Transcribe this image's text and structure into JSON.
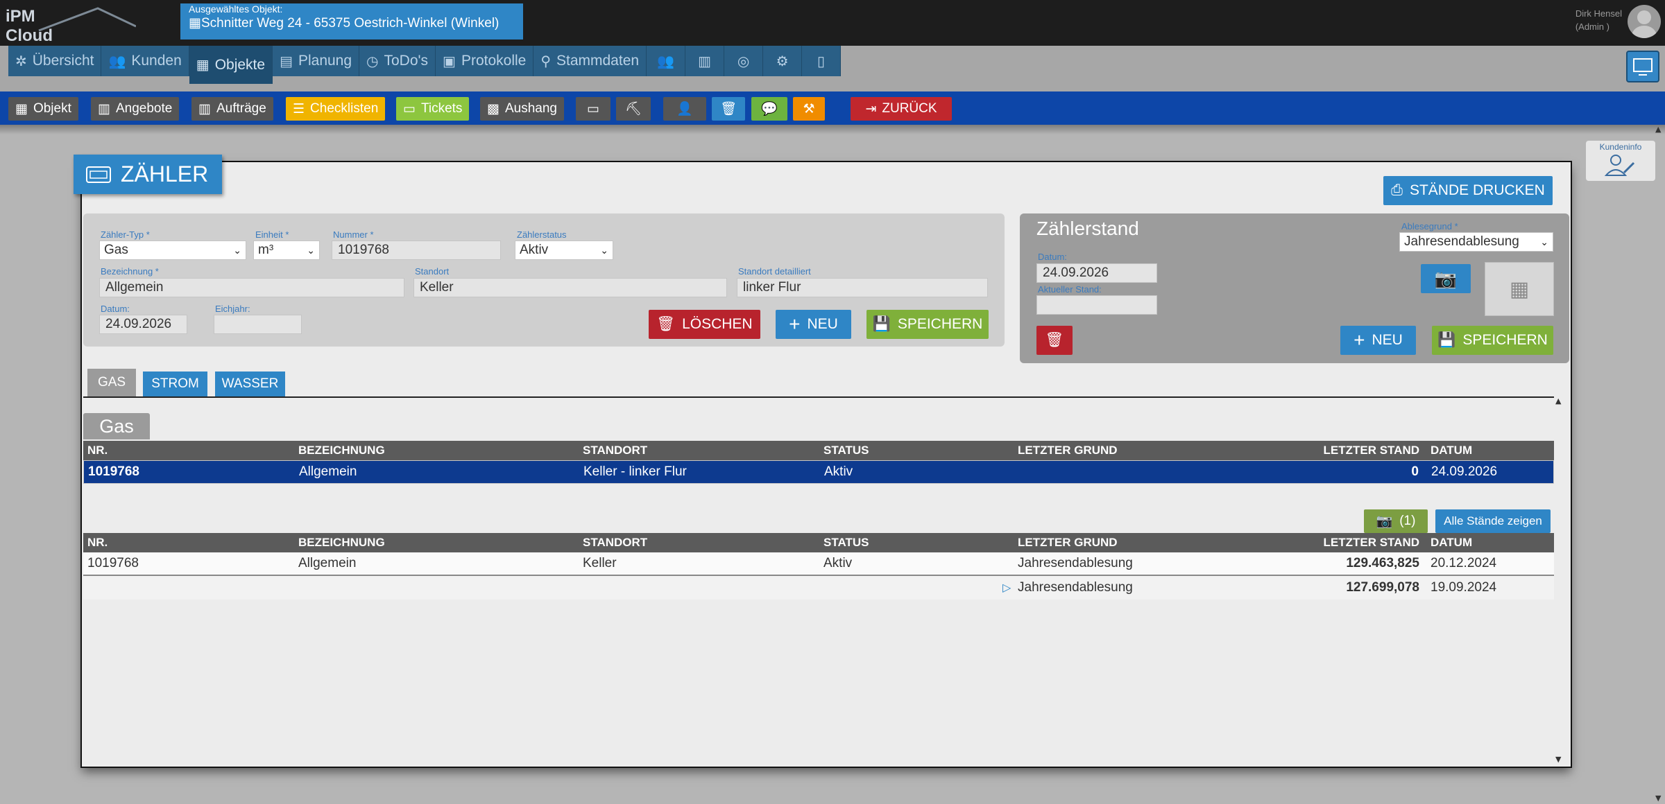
{
  "logo": {
    "line1": "iPM",
    "line2": "Cloud"
  },
  "object_selector": {
    "label": "Ausgewähltes Objekt:",
    "value": "Schnitter Weg 24 - 65375 Oestrich-Winkel (Winkel)"
  },
  "user": {
    "name": "Dirk Hensel",
    "role": "(Admin )"
  },
  "nav": {
    "items": [
      {
        "label": "Übersicht",
        "icon": "network-icon"
      },
      {
        "label": "Kunden",
        "icon": "users-icon"
      },
      {
        "label": "Objekte",
        "icon": "building-icon",
        "active": true
      },
      {
        "label": "Planung",
        "icon": "clipboard-icon"
      },
      {
        "label": "ToDo's",
        "icon": "clock-icon"
      },
      {
        "label": "Protokolle",
        "icon": "document-icon"
      },
      {
        "label": "Stammdaten",
        "icon": "hierarchy-icon"
      }
    ]
  },
  "toolbar": {
    "objekt": "Objekt",
    "angebote": "Angebote",
    "auftraege": "Aufträge",
    "checklisten": "Checklisten",
    "tickets": "Tickets",
    "aushang": "Aushang",
    "zurueck": "ZURÜCK"
  },
  "kundeninfo": "Kundeninfo",
  "page": {
    "title": "ZÄHLER",
    "print_button": "STÄNDE DRUCKEN"
  },
  "form": {
    "typ_label": "Zähler-Typ *",
    "typ_value": "Gas",
    "einheit_label": "Einheit *",
    "einheit_value": "m³",
    "nummer_label": "Nummer *",
    "nummer_value": "1019768",
    "status_label": "Zählerstatus",
    "status_value": "Aktiv",
    "bez_label": "Bezeichnung *",
    "bez_value": "Allgemein",
    "standort_label": "Standort",
    "standort_value": "Keller",
    "standort_det_label": "Standort detailliert",
    "standort_det_value": "linker Flur",
    "datum_label": "Datum:",
    "datum_value": "24.09.2026",
    "eichjahr_label": "Eichjahr:",
    "eichjahr_value": "",
    "delete": "LÖSCHEN",
    "new": "NEU",
    "save": "SPEICHERN"
  },
  "reading": {
    "title": "Zählerstand",
    "grund_label": "Ablesegrund *",
    "grund_value": "Jahresendablesung",
    "datum_label": "Datum:",
    "datum_value": "24.09.2026",
    "stand_label": "Aktueller Stand:",
    "stand_value": "",
    "new": "NEU",
    "save": "SPEICHERN"
  },
  "tabs": [
    "GAS",
    "STROM",
    "WASSER"
  ],
  "group_label": "Gas",
  "columns": [
    "NR.",
    "BEZEICHNUNG",
    "STANDORT",
    "STATUS",
    "LETZTER GRUND",
    "LETZTER STAND",
    "DATUM"
  ],
  "meters": [
    {
      "nr": "1019768",
      "bez": "Allgemein",
      "standort": "Keller - linker Flur",
      "status": "Aktiv",
      "grund": "",
      "stand": "0",
      "datum": "24.09.2026"
    }
  ],
  "history_controls": {
    "photo_count": "(1)",
    "show_all": "Alle Stände zeigen"
  },
  "history": [
    {
      "nr": "1019768",
      "bez": "Allgemein",
      "standort": "Keller",
      "status": "Aktiv",
      "grund": "Jahresendablesung",
      "stand": "129.463,825",
      "datum": "20.12.2024"
    },
    {
      "nr": "",
      "bez": "",
      "standort": "",
      "status": "",
      "grund": "Jahresendablesung",
      "stand": "127.699,078",
      "datum": "19.09.2024"
    }
  ],
  "colors": {
    "primary": "#2f86c6",
    "toolbar": "#0d46a8",
    "danger": "#b8232d",
    "success": "#7fb03a",
    "selected_row": "#0d3a8f"
  }
}
